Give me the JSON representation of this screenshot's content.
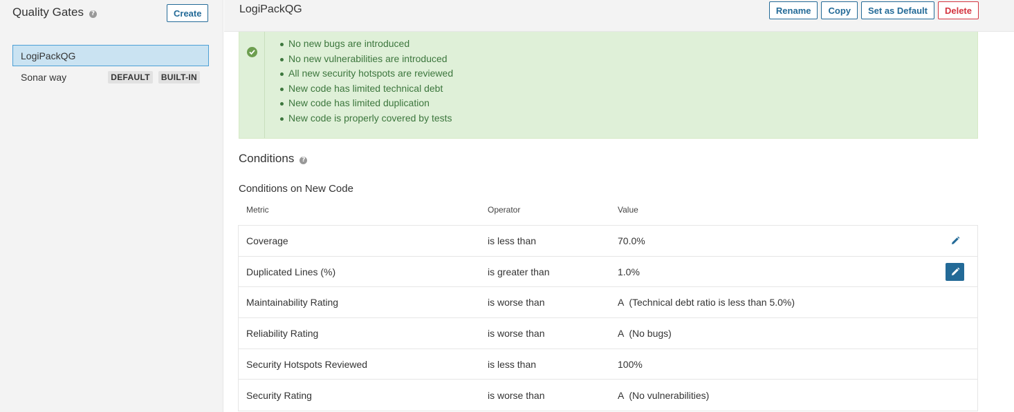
{
  "sidebar": {
    "title": "Quality Gates",
    "create_label": "Create",
    "items": [
      {
        "name": "LogiPackQG",
        "active": true,
        "badges": []
      },
      {
        "name": "Sonar way",
        "active": false,
        "badges": [
          "DEFAULT",
          "BUILT-IN"
        ]
      }
    ]
  },
  "main": {
    "gate_title": "LogiPackQG",
    "actions": {
      "rename": "Rename",
      "copy": "Copy",
      "set_default": "Set as Default",
      "delete": "Delete"
    },
    "success_items": [
      "No new bugs are introduced",
      "No new vulnerabilities are introduced",
      "All new security hotspots are reviewed",
      "New code has limited technical debt",
      "New code has limited duplication",
      "New code is properly covered by tests"
    ],
    "conditions_title": "Conditions",
    "conditions_subtitle": "Conditions on New Code",
    "columns": {
      "metric": "Metric",
      "operator": "Operator",
      "value": "Value"
    },
    "rows": [
      {
        "metric": "Coverage",
        "operator": "is less than",
        "rating": "",
        "value": "70.0%"
      },
      {
        "metric": "Duplicated Lines (%)",
        "operator": "is greater than",
        "rating": "",
        "value": "1.0%"
      },
      {
        "metric": "Maintainability Rating",
        "operator": "is worse than",
        "rating": "A",
        "value": "(Technical debt ratio is less than 5.0%)"
      },
      {
        "metric": "Reliability Rating",
        "operator": "is worse than",
        "rating": "A",
        "value": "(No bugs)"
      },
      {
        "metric": "Security Hotspots Reviewed",
        "operator": "is less than",
        "rating": "",
        "value": "100%"
      },
      {
        "metric": "Security Rating",
        "operator": "is worse than",
        "rating": "A",
        "value": "(No vulnerabilities)"
      }
    ]
  },
  "colors": {
    "primary": "#236a97",
    "danger": "#d4333f",
    "success_bg": "#dff0d8",
    "success_text": "#3c763d",
    "active_item_bg": "#cae3f2"
  }
}
